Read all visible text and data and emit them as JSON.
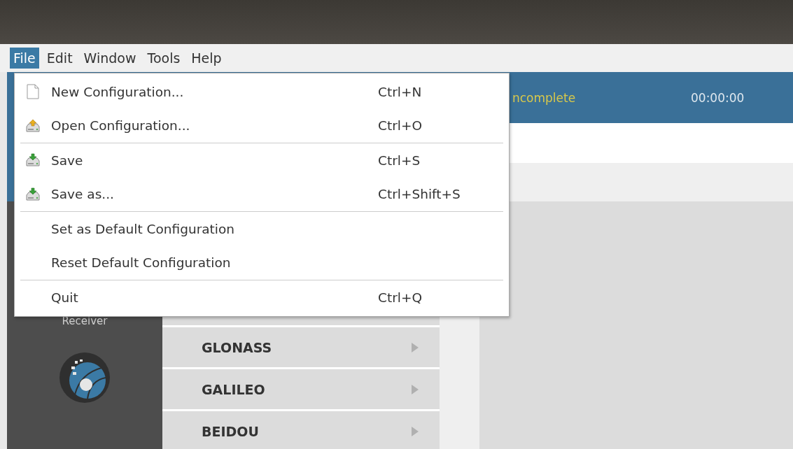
{
  "menubar": [
    {
      "label": "File",
      "selected": true
    },
    {
      "label": "Edit",
      "selected": false
    },
    {
      "label": "Window",
      "selected": false
    },
    {
      "label": "Tools",
      "selected": false
    },
    {
      "label": "Help",
      "selected": false
    }
  ],
  "file_menu": [
    {
      "kind": "page",
      "label": "New Configuration...",
      "shortcut": "Ctrl+N"
    },
    {
      "kind": "open",
      "label": "Open Configuration...",
      "shortcut": "Ctrl+O"
    },
    {
      "kind": "separator"
    },
    {
      "kind": "save",
      "label": "Save",
      "shortcut": "Ctrl+S"
    },
    {
      "kind": "save",
      "label": "Save as...",
      "shortcut": "Ctrl+Shift+S"
    },
    {
      "kind": "separator"
    },
    {
      "kind": "plain",
      "label": "Set as Default Configuration"
    },
    {
      "kind": "plain",
      "label": "Reset Default Configuration"
    },
    {
      "kind": "separator"
    },
    {
      "kind": "plain",
      "label": "Quit",
      "shortcut": "Ctrl+Q"
    }
  ],
  "header": {
    "status": "ncomplete",
    "time": "00:00:00"
  },
  "sidebar": {
    "items": [
      {
        "kind": "label",
        "label": "Receiver"
      },
      {
        "kind": "globe"
      }
    ]
  },
  "constellations": [
    {
      "label": "GLONASS"
    },
    {
      "label": "GALILEO"
    },
    {
      "label": "BEIDOU"
    }
  ]
}
